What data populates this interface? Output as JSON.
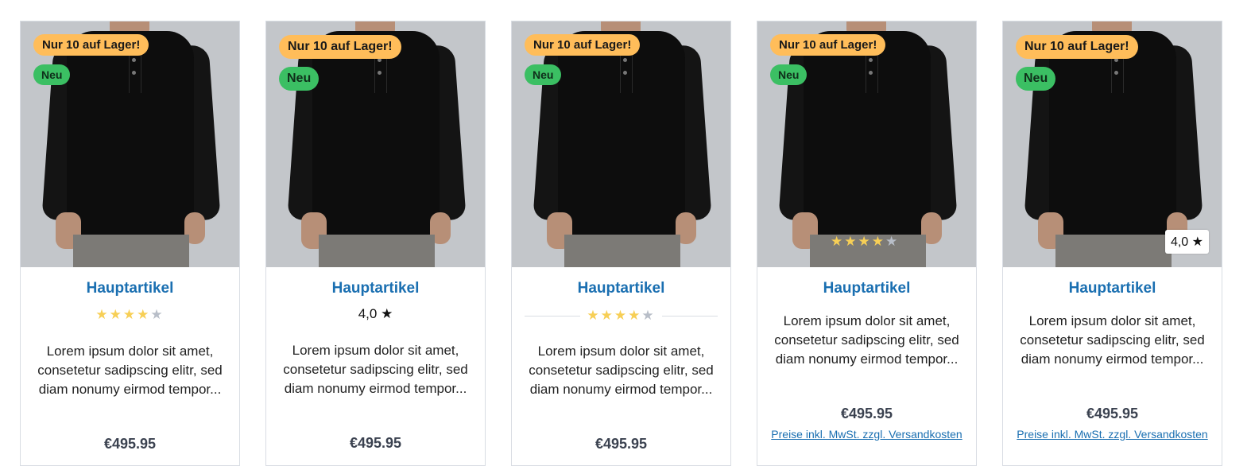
{
  "products": [
    {
      "stock_badge": "Nur 10 auf Lager!",
      "new_badge": "Neu",
      "title": "Hauptartikel",
      "rating_style": "stars",
      "rating": 4,
      "rating_text": "",
      "description": "Lorem ipsum dolor sit amet, consetetur sadipscing elitr, sed diam nonumy eirmod tempor...",
      "price": "€495.95",
      "tax_note": ""
    },
    {
      "stock_badge": "Nur 10 auf Lager!",
      "new_badge": "Neu",
      "title": "Hauptartikel",
      "rating_style": "number",
      "rating": 4,
      "rating_text": "4,0",
      "description": "Lorem ipsum dolor sit amet, consetetur sadipscing elitr, sed diam nonumy eirmod tempor...",
      "price": "€495.95",
      "tax_note": ""
    },
    {
      "stock_badge": "Nur 10 auf Lager!",
      "new_badge": "Neu",
      "title": "Hauptartikel",
      "rating_style": "stars-divider",
      "rating": 4,
      "rating_text": "",
      "description": "Lorem ipsum dolor sit amet, consetetur sadipscing elitr, sed diam nonumy eirmod tempor...",
      "price": "€495.95",
      "tax_note": ""
    },
    {
      "stock_badge": "Nur 10 auf Lager!",
      "new_badge": "Neu",
      "title": "Hauptartikel",
      "rating_style": "image-stars",
      "rating": 4,
      "rating_text": "",
      "description": "Lorem ipsum dolor sit amet, consetetur sadipscing elitr, sed diam nonumy eirmod tempor...",
      "price": "€495.95",
      "tax_note": "Preise inkl. MwSt. zzgl. Versandkosten"
    },
    {
      "stock_badge": "Nur 10 auf Lager!",
      "new_badge": "Neu",
      "title": "Hauptartikel",
      "rating_style": "image-number",
      "rating": 4,
      "rating_text": "4,0",
      "description": "Lorem ipsum dolor sit amet, consetetur sadipscing elitr, sed diam nonumy eirmod tempor...",
      "price": "€495.95",
      "tax_note": "Preise inkl. MwSt. zzgl. Versandkosten"
    }
  ],
  "colors": {
    "stock_badge": "#ffbd5a",
    "new_badge": "#3bbf63",
    "title_link": "#1a6fb1",
    "star_on": "#f7cf56",
    "star_off": "#b8bec8"
  }
}
